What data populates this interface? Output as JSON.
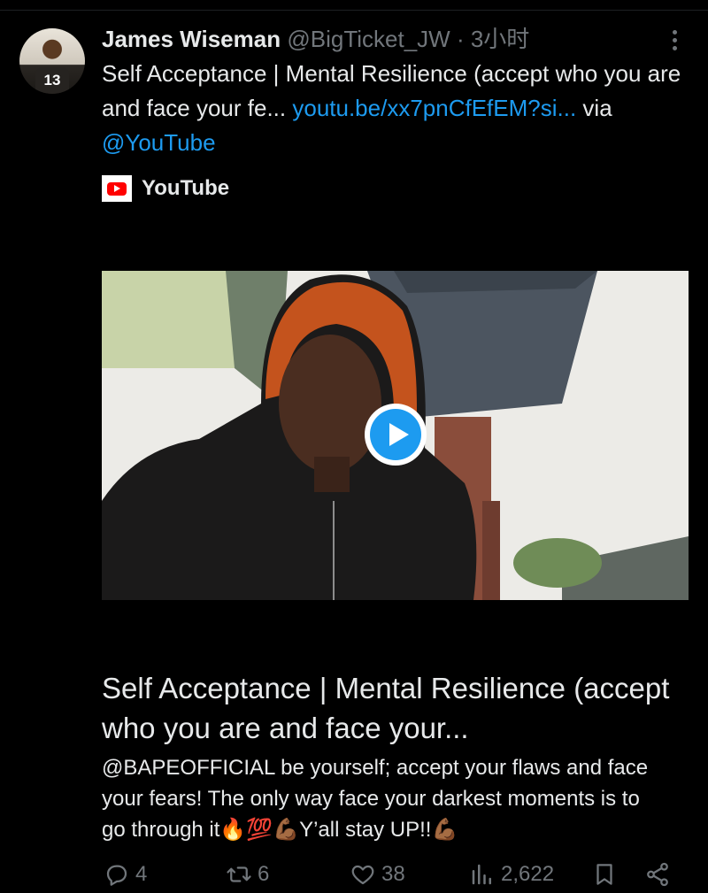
{
  "tweet": {
    "author_name": "James Wiseman",
    "author_handle": "@BigTicket_JW",
    "separator": "·",
    "time": "3小时",
    "avatar_jersey_number": "13",
    "text_main": "Self Acceptance | Mental Resilience (accept who you are and face your fe... ",
    "text_link": "youtu.be/xx7pnCfEfEM?si...",
    "text_via": " via ",
    "text_mention": "@YouTube"
  },
  "card": {
    "source_label": "YouTube",
    "title": "Self Acceptance | Mental Resilience (accept who you are and face your...",
    "description": "@BAPEOFFICIAL be yourself; accept your flaws and face your fears! The only way face your darkest moments is to go through it🔥💯💪🏾Y’all stay UP!!💪🏾"
  },
  "actions": {
    "replies": "4",
    "reposts": "6",
    "likes": "38",
    "views": "2,622"
  },
  "colors": {
    "background": "#000000",
    "text": "#e7e9ea",
    "secondary": "#71767b",
    "link": "#1d9bf0",
    "youtube_red": "#ff0000"
  },
  "icons": [
    "more-icon",
    "youtube-icon",
    "play-icon",
    "reply-icon",
    "repost-icon",
    "like-icon",
    "views-icon",
    "bookmark-icon",
    "share-icon"
  ]
}
